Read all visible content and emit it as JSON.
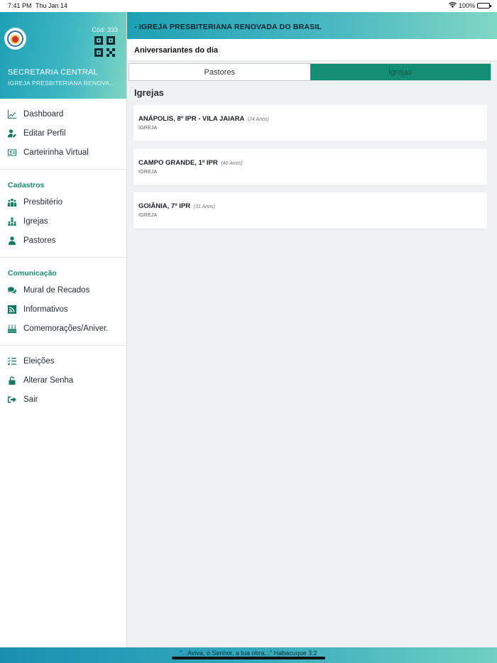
{
  "status": {
    "time": "7:41 PM",
    "date": "Thu Jan 14",
    "battery": "100%"
  },
  "sidebar": {
    "cod": "Cód: 333",
    "org_name": "SECRETARIA CENTRAL",
    "org_sub": "IGREJA PRESBITERIANA RENOVA...",
    "groups": [
      {
        "title": "",
        "items": [
          {
            "label": "Dashboard",
            "icon": "chart-line-icon"
          },
          {
            "label": "Editar Perfil",
            "icon": "user-edit-icon"
          },
          {
            "label": "Carteirinha Virtual",
            "icon": "id-card-icon"
          }
        ]
      },
      {
        "title": "Cadastros",
        "items": [
          {
            "label": "Presbitério",
            "icon": "people-group-icon"
          },
          {
            "label": "Igrejas",
            "icon": "sitemap-icon"
          },
          {
            "label": "Pastores",
            "icon": "user-tie-icon"
          }
        ]
      },
      {
        "title": "Comunicação",
        "items": [
          {
            "label": "Mural de Recados",
            "icon": "comments-icon"
          },
          {
            "label": "Informativos",
            "icon": "rss-icon"
          },
          {
            "label": "Comemorações/Aniver.",
            "icon": "birthday-cake-icon"
          }
        ]
      },
      {
        "title": "",
        "items": [
          {
            "label": "Eleições",
            "icon": "list-check-icon"
          },
          {
            "label": "Alterar Senha",
            "icon": "unlock-icon"
          },
          {
            "label": "Sair",
            "icon": "sign-out-icon"
          }
        ]
      }
    ]
  },
  "main": {
    "topbar_title": "- IGREJA PRESBITERIANA RENOVADA DO BRASIL",
    "subheader_title": "Aniversariantes do dia",
    "tabs": [
      {
        "label": "Pastores",
        "active": false
      },
      {
        "label": "Igrejas",
        "active": true
      }
    ],
    "section_title": "Igrejas",
    "cards": [
      {
        "title": "ANÁPOLIS, 8º IPR - VILA JAIARA",
        "age": "(24 Anos)",
        "type": "IGREJA"
      },
      {
        "title": "CAMPO GRANDE, 1º IPR",
        "age": "(40 Anos)",
        "type": "IGREJA"
      },
      {
        "title": "GOIÂNIA, 7º IPR",
        "age": "(31 Anos)",
        "type": "IGREJA"
      }
    ]
  },
  "footer": {
    "verse": "\"...Aviva, ó Senhor, a tua obra...\" Habacuque 3:2"
  },
  "colors": {
    "accent": "#138d74",
    "header_gradient_start": "#1ea0b4",
    "header_gradient_end": "#80d7c4",
    "icon": "#137a66"
  }
}
